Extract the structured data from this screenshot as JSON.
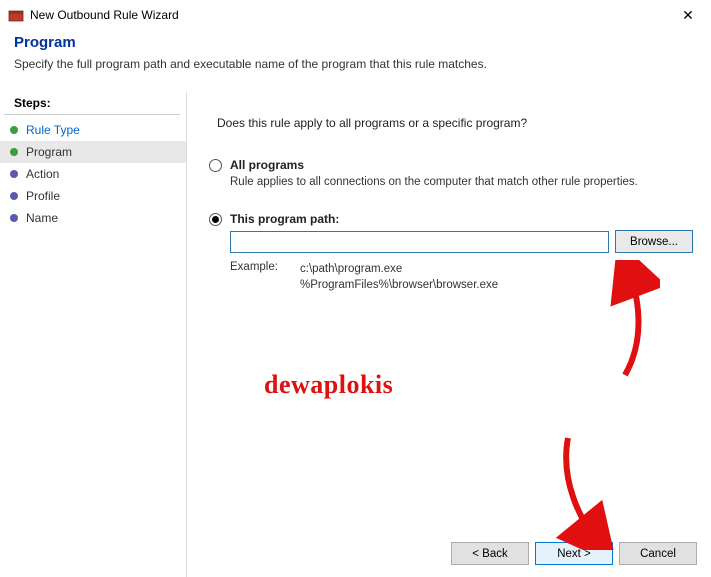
{
  "window": {
    "title": "New Outbound Rule Wizard"
  },
  "header": {
    "title": "Program",
    "subtitle": "Specify the full program path and executable name of the program that this rule matches."
  },
  "sidebar": {
    "heading": "Steps:",
    "items": [
      {
        "label": "Rule Type"
      },
      {
        "label": "Program"
      },
      {
        "label": "Action"
      },
      {
        "label": "Profile"
      },
      {
        "label": "Name"
      }
    ]
  },
  "main": {
    "question": "Does this rule apply to all programs or a specific program?",
    "option_all": {
      "label": "All programs",
      "desc": "Rule applies to all connections on the computer that match other rule properties."
    },
    "option_path": {
      "label": "This program path:",
      "value": "",
      "browse": "Browse...",
      "example_label": "Example:",
      "example_line1": "c:\\path\\program.exe",
      "example_line2": "%ProgramFiles%\\browser\\browser.exe"
    }
  },
  "buttons": {
    "back": "< Back",
    "next": "Next >",
    "cancel": "Cancel"
  },
  "watermark": "dewaplokis"
}
